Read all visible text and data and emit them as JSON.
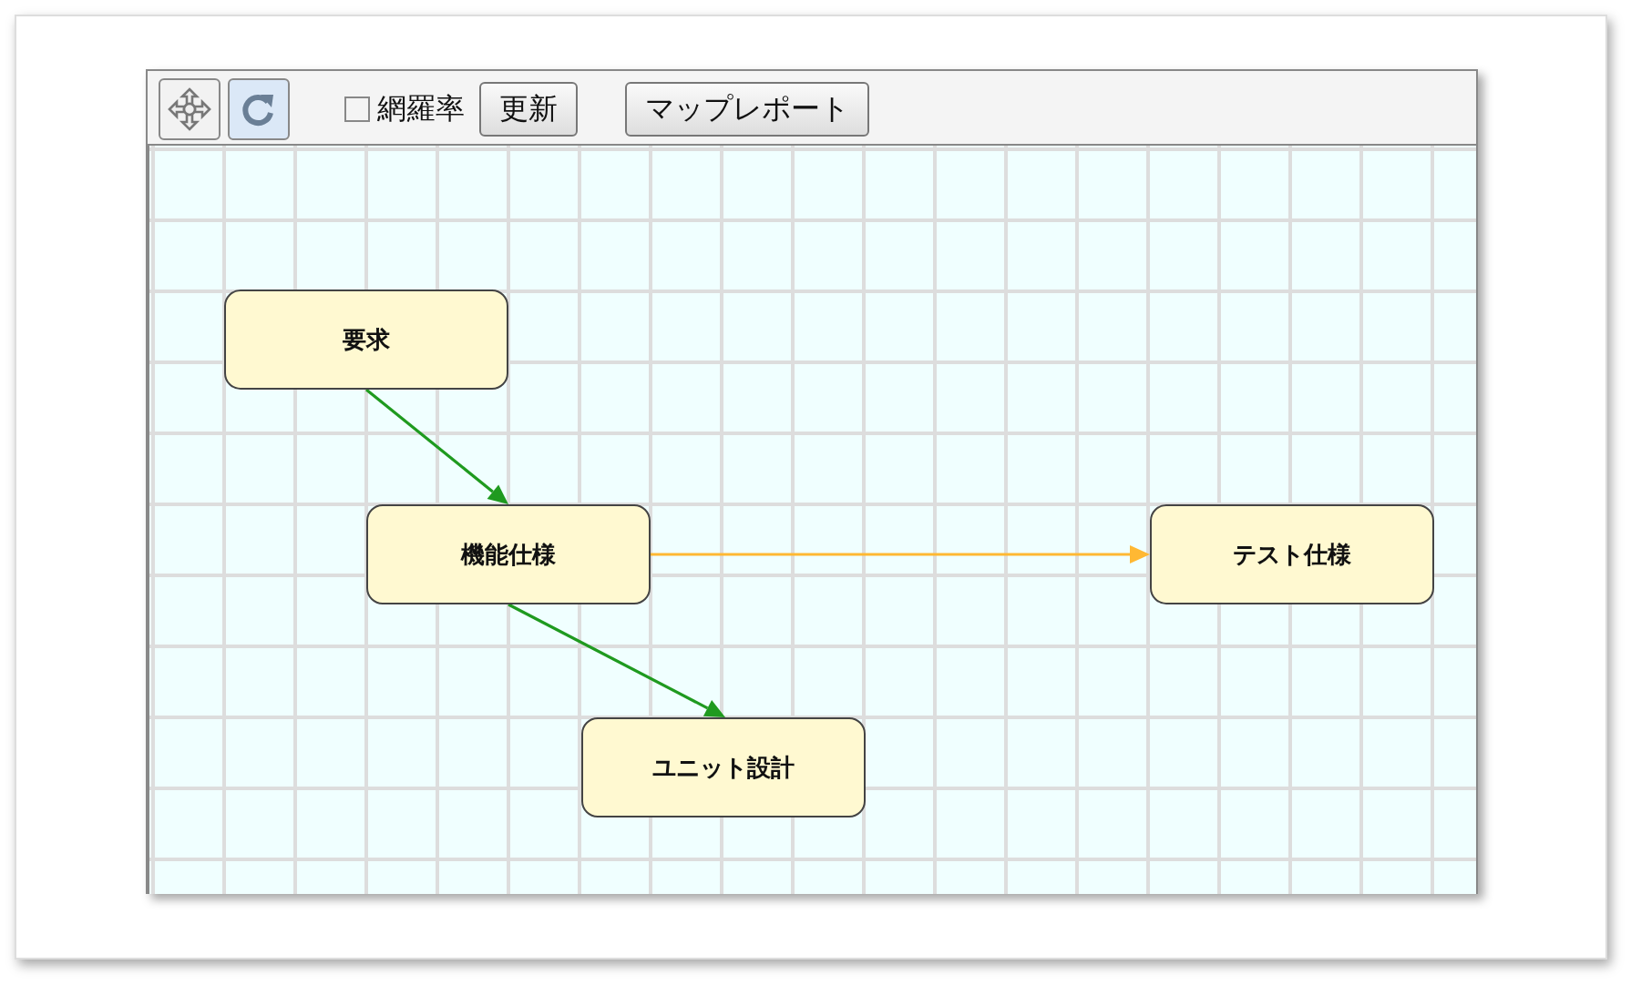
{
  "toolbar": {
    "tools": [
      {
        "kind": "move",
        "selected": false
      },
      {
        "kind": "refresh",
        "selected": true
      }
    ],
    "coverage": {
      "label": "網羅率",
      "checked": false
    },
    "buttons": [
      "更新",
      "マップレポート"
    ]
  },
  "diagram": {
    "nodes": [
      {
        "label": "要求"
      },
      {
        "label": "機能仕様"
      },
      {
        "label": "テスト仕様"
      },
      {
        "label": "ユニット設計"
      }
    ],
    "edges": [
      {
        "color": "#1f9a1f"
      },
      {
        "color": "#ffb833"
      },
      {
        "color": "#1f9a1f"
      }
    ]
  }
}
